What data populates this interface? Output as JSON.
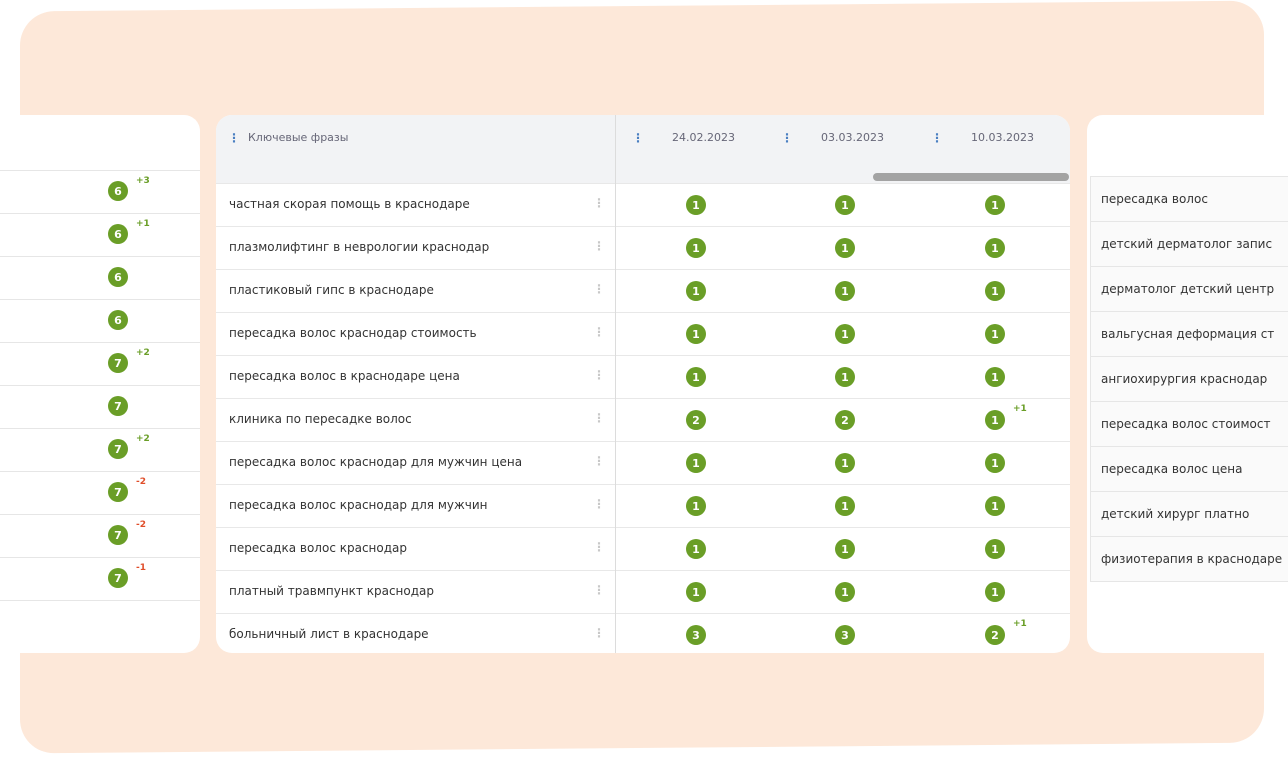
{
  "left_panel": {
    "rows": [
      {
        "position": "6",
        "delta": "+3",
        "dir": "up"
      },
      {
        "position": "6",
        "delta": "+1",
        "dir": "up"
      },
      {
        "position": "6",
        "delta": "",
        "dir": ""
      },
      {
        "position": "6",
        "delta": "",
        "dir": ""
      },
      {
        "position": "7",
        "delta": "+2",
        "dir": "up"
      },
      {
        "position": "7",
        "delta": "",
        "dir": ""
      },
      {
        "position": "7",
        "delta": "+2",
        "dir": "up"
      },
      {
        "position": "7",
        "delta": "-2",
        "dir": "down"
      },
      {
        "position": "7",
        "delta": "-2",
        "dir": "down"
      },
      {
        "position": "7",
        "delta": "-1",
        "dir": "down"
      }
    ]
  },
  "main_table": {
    "keyword_header": "Ключевые фразы",
    "dates": [
      "24.02.2023",
      "03.03.2023",
      "10.03.2023"
    ],
    "rows": [
      {
        "keyword": "частная скорая помощь в краснодаре",
        "positions": [
          "1",
          "1",
          "1"
        ],
        "delta": ""
      },
      {
        "keyword": "плазмолифтинг в неврологии краснодар",
        "positions": [
          "1",
          "1",
          "1"
        ],
        "delta": ""
      },
      {
        "keyword": "пластиковый гипс в краснодаре",
        "positions": [
          "1",
          "1",
          "1"
        ],
        "delta": ""
      },
      {
        "keyword": "пересадка волос краснодар стоимость",
        "positions": [
          "1",
          "1",
          "1"
        ],
        "delta": ""
      },
      {
        "keyword": "пересадка волос в краснодаре цена",
        "positions": [
          "1",
          "1",
          "1"
        ],
        "delta": ""
      },
      {
        "keyword": "клиника по пересадке волос",
        "positions": [
          "2",
          "2",
          "1"
        ],
        "delta": "+1"
      },
      {
        "keyword": "пересадка волос краснодар для мужчин цена",
        "positions": [
          "1",
          "1",
          "1"
        ],
        "delta": ""
      },
      {
        "keyword": "пересадка волос краснодар для мужчин",
        "positions": [
          "1",
          "1",
          "1"
        ],
        "delta": ""
      },
      {
        "keyword": "пересадка волос краснодар",
        "positions": [
          "1",
          "1",
          "1"
        ],
        "delta": ""
      },
      {
        "keyword": "платный травмпункт краснодар",
        "positions": [
          "1",
          "1",
          "1"
        ],
        "delta": ""
      },
      {
        "keyword": "больничный лист в краснодаре",
        "positions": [
          "3",
          "3",
          "2"
        ],
        "delta": "+1"
      }
    ]
  },
  "right_panel": {
    "items": [
      "пересадка волос",
      "детский дерматолог запис",
      "дерматолог детский центр",
      "вальгусная деформация ст",
      "ангиохирургия краснодар",
      "пересадка волос стоимост",
      "пересадка волос цена",
      "детский хирург платно",
      "физиотерапия в краснодаре"
    ]
  },
  "colors": {
    "badge": "#6a9e27",
    "delta_up": "#6a9e27",
    "delta_down": "#e04e2a",
    "background": "#fde8d9"
  }
}
